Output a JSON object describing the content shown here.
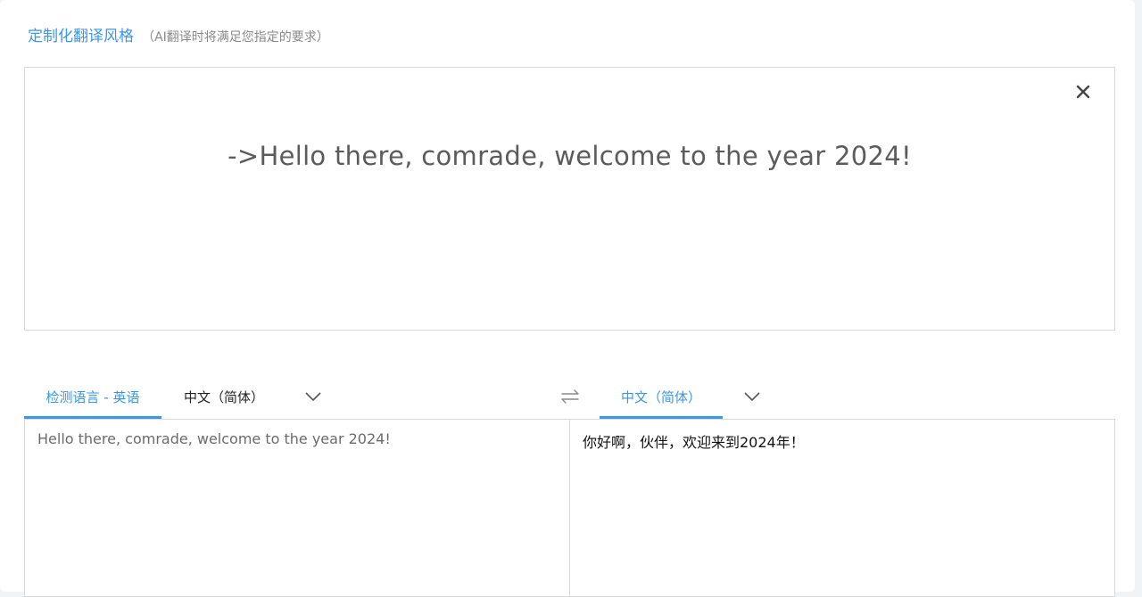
{
  "header": {
    "title": "定制化翻译风格",
    "subtitle": "（AI翻译时将满足您指定的要求）"
  },
  "style_box": {
    "text": "->Hello there, comrade, welcome to the year 2024!"
  },
  "source": {
    "detect_tab": "检测语言 - 英语",
    "language": "中文（简体）",
    "text": "Hello there, comrade, welcome to the year 2024!"
  },
  "target": {
    "language": "中文（简体）",
    "text": "你好啊，伙伴，欢迎来到2024年！"
  },
  "colors": {
    "accent": "#3a97e6",
    "border": "#d9d9d9"
  },
  "icons": [
    "close-icon",
    "chevron-down-icon",
    "swap-icon"
  ]
}
